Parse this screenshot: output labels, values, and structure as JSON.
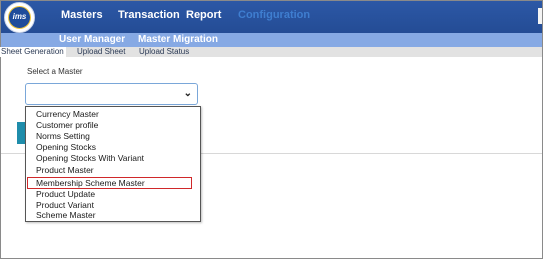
{
  "app": {
    "logo_text": "ims"
  },
  "top_menu": [
    {
      "label": "Masters"
    },
    {
      "label": "Transaction"
    },
    {
      "label": "Report"
    },
    {
      "label": "Configuration"
    }
  ],
  "sub_menu": [
    {
      "label": "User Manager"
    },
    {
      "label": "Master Migration"
    }
  ],
  "tabs": [
    {
      "label": "Sheet Generation",
      "active": true
    },
    {
      "label": "Upload Sheet"
    },
    {
      "label": "Upload Status"
    }
  ],
  "form": {
    "select_label": "Select a Master",
    "selected_value": "",
    "options": [
      "Currency Master",
      "Customer profile",
      "Norms Setting",
      "Opening Stocks",
      "Opening Stocks With Variant",
      "Product Master",
      "Membership Scheme Master",
      "Product Update",
      "Product Variant",
      "Scheme Master"
    ],
    "highlighted_option": "Membership Scheme Master"
  },
  "colors": {
    "header": "#2c58a6",
    "subheader": "#86a9e4",
    "highlight": "#d0282a",
    "button": "#1f8dab"
  }
}
